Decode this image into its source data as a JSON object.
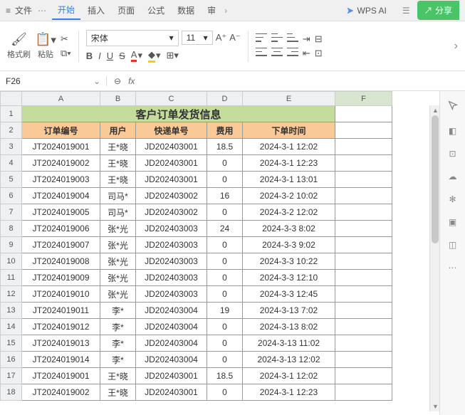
{
  "tabbar": {
    "file": "文件",
    "tabs": [
      "开始",
      "插入",
      "页面",
      "公式",
      "数据",
      "审"
    ],
    "active": 0,
    "ai": "WPS AI",
    "share": "分享"
  },
  "ribbon": {
    "format_brush": "格式刷",
    "paste": "粘贴",
    "font_name": "宋体",
    "font_size": "11",
    "bold": "B",
    "italic": "I",
    "underline": "U",
    "strike": "S"
  },
  "namebox": {
    "cell": "F26",
    "fx": "fx"
  },
  "sheet": {
    "cols": [
      "A",
      "B",
      "C",
      "D",
      "E",
      "F"
    ],
    "title": "客户订单发货信息",
    "headers": [
      "订单编号",
      "用户",
      "快递单号",
      "费用",
      "下单时间"
    ],
    "rows": [
      [
        "JT2024019001",
        "王*晓",
        "JD202403001",
        "18.5",
        "2024-3-1 12:02"
      ],
      [
        "JT2024019002",
        "王*晓",
        "JD202403001",
        "0",
        "2024-3-1 12:23"
      ],
      [
        "JT2024019003",
        "王*晓",
        "JD202403001",
        "0",
        "2024-3-1 13:01"
      ],
      [
        "JT2024019004",
        "司马*",
        "JD202403002",
        "16",
        "2024-3-2 10:02"
      ],
      [
        "JT2024019005",
        "司马*",
        "JD202403002",
        "0",
        "2024-3-2 12:02"
      ],
      [
        "JT2024019006",
        "张*光",
        "JD202403003",
        "24",
        "2024-3-3 8:02"
      ],
      [
        "JT2024019007",
        "张*光",
        "JD202403003",
        "0",
        "2024-3-3 9:02"
      ],
      [
        "JT2024019008",
        "张*光",
        "JD202403003",
        "0",
        "2024-3-3 10:22"
      ],
      [
        "JT2024019009",
        "张*光",
        "JD202403003",
        "0",
        "2024-3-3 12:10"
      ],
      [
        "JT2024019010",
        "张*光",
        "JD202403003",
        "0",
        "2024-3-3 12:45"
      ],
      [
        "JT2024019011",
        "李*",
        "JD202403004",
        "19",
        "2024-3-13 7:02"
      ],
      [
        "JT2024019012",
        "李*",
        "JD202403004",
        "0",
        "2024-3-13 8:02"
      ],
      [
        "JT2024019013",
        "李*",
        "JD202403004",
        "0",
        "2024-3-13 11:02"
      ],
      [
        "JT2024019014",
        "李*",
        "JD202403004",
        "0",
        "2024-3-13 12:02"
      ],
      [
        "JT2024019001",
        "王*晓",
        "JD202403001",
        "18.5",
        "2024-3-1 12:02"
      ],
      [
        "JT2024019002",
        "王*晓",
        "JD202403001",
        "0",
        "2024-3-1 12:23"
      ]
    ]
  }
}
